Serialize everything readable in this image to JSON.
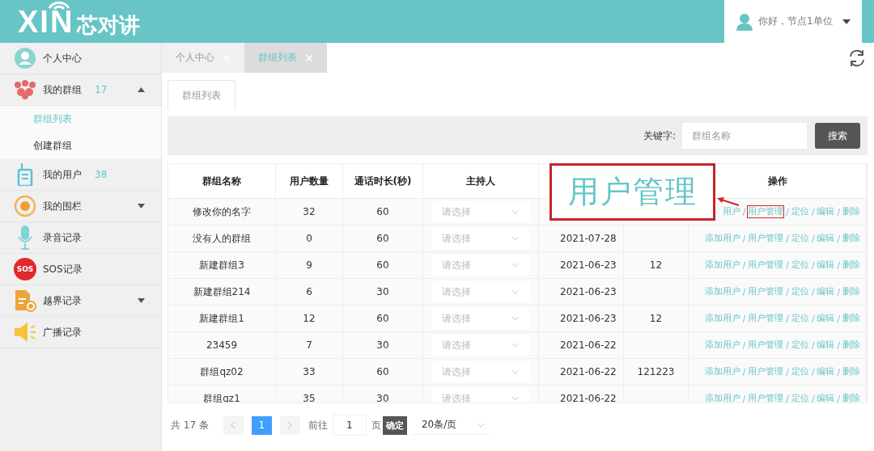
{
  "header": {
    "logo": {
      "latin": "XIN",
      "cjk": "芯对讲"
    },
    "user": {
      "greeting": "你好，节点1单位"
    }
  },
  "sidebar": {
    "items": [
      {
        "kind": "avatar",
        "label": "个人中心"
      },
      {
        "kind": "group",
        "label": "我的群组",
        "count": "17",
        "expanded": true,
        "children": [
          {
            "label": "群组列表",
            "selected": true
          },
          {
            "label": "创建群组",
            "selected": false
          }
        ]
      },
      {
        "kind": "radio",
        "label": "我的用户",
        "count": "38"
      },
      {
        "kind": "fence",
        "label": "我的围栏",
        "expanded": false
      },
      {
        "kind": "mic",
        "label": "录音记录"
      },
      {
        "kind": "sos",
        "icon_text": "SOS",
        "label": "SOS记录"
      },
      {
        "kind": "document",
        "label": "越界记录",
        "expanded": false
      },
      {
        "kind": "speaker",
        "label": "广播记录"
      }
    ]
  },
  "tabs": [
    {
      "label": "个人中心",
      "selected": false
    },
    {
      "label": "群组列表",
      "selected": true
    }
  ],
  "inner_tabs": [
    {
      "label": "群组列表",
      "selected": true
    }
  ],
  "search": {
    "label": "关键字:",
    "placeholder": "群组名称",
    "button": "搜索"
  },
  "table": {
    "columns": [
      "群组名称",
      "用户数量",
      "通话时长(秒)",
      "主持人",
      "操作"
    ],
    "rows": [
      {
        "name": "修改你的名字",
        "users": "32",
        "duration": "60",
        "host_placeholder": "请选择",
        "callout": true,
        "actions": [
          {
            "label": "用户"
          },
          {
            "separator": "/",
            "label": "用户管理"
          },
          {
            "separator": "/",
            "label": "定位"
          },
          {
            "separator": "/",
            "label": "编辑"
          },
          {
            "separator": "/",
            "label": "删除"
          }
        ]
      },
      {
        "name": "没有人的群组",
        "users": "0",
        "duration": "60",
        "host_placeholder": "请选择",
        "date": "2021-07-28",
        "actions": [
          {
            "label": "添加用户"
          },
          {
            "separator": "/",
            "label": "用户管理"
          },
          {
            "separator": "/",
            "label": "定位"
          },
          {
            "separator": "/",
            "label": "编辑"
          },
          {
            "separator": "/",
            "label": "删除"
          }
        ]
      },
      {
        "name": "新建群组3",
        "users": "9",
        "duration": "60",
        "host_placeholder": "请选择",
        "date": "2021-06-23",
        "extra": "12",
        "actions": [
          {
            "label": "添加用户"
          },
          {
            "separator": "/",
            "label": "用户管理"
          },
          {
            "separator": "/",
            "label": "定位"
          },
          {
            "separator": "/",
            "label": "编辑"
          },
          {
            "separator": "/",
            "label": "删除"
          }
        ]
      },
      {
        "name": "新建群组214",
        "users": "6",
        "duration": "30",
        "host_placeholder": "请选择",
        "date": "2021-06-23",
        "actions": [
          {
            "label": "添加用户"
          },
          {
            "separator": "/",
            "label": "用户管理"
          },
          {
            "separator": "/",
            "label": "定位"
          },
          {
            "separator": "/",
            "label": "编辑"
          },
          {
            "separator": "/",
            "label": "删除"
          }
        ]
      },
      {
        "name": "新建群组1",
        "users": "12",
        "duration": "60",
        "host_placeholder": "请选择",
        "date": "2021-06-23",
        "extra": "12",
        "actions": [
          {
            "label": "添加用户"
          },
          {
            "separator": "/",
            "label": "用户管理"
          },
          {
            "separator": "/",
            "label": "定位"
          },
          {
            "separator": "/",
            "label": "编辑"
          },
          {
            "separator": "/",
            "label": "删除"
          }
        ]
      },
      {
        "name": "23459",
        "users": "7",
        "duration": "30",
        "host_placeholder": "请选择",
        "date": "2021-06-22",
        "actions": [
          {
            "label": "添加用户"
          },
          {
            "separator": "/",
            "label": "用户管理"
          },
          {
            "separator": "/",
            "label": "定位"
          },
          {
            "separator": "/",
            "label": "编辑"
          },
          {
            "separator": "/",
            "label": "删除"
          }
        ]
      },
      {
        "name": "群组qz02",
        "users": "33",
        "duration": "60",
        "host_placeholder": "请选择",
        "date": "2021-06-22",
        "extra": "121223",
        "actions": [
          {
            "label": "添加用户"
          },
          {
            "separator": "/",
            "label": "用户管理"
          },
          {
            "separator": "/",
            "label": "定位"
          },
          {
            "separator": "/",
            "label": "编辑"
          },
          {
            "separator": "/",
            "label": "删除"
          }
        ]
      },
      {
        "name": "群组qz1",
        "users": "35",
        "duration": "30",
        "host_placeholder": "请选择",
        "date": "2021-06-22",
        "actions": [
          {
            "label": "添加用户"
          },
          {
            "separator": "/",
            "label": "用户管理"
          },
          {
            "separator": "/",
            "label": "定位"
          },
          {
            "separator": "/",
            "label": "编辑"
          },
          {
            "separator": "/",
            "label": "删除"
          }
        ]
      }
    ]
  },
  "callout": {
    "text": "用户管理"
  },
  "pagination": {
    "total": "共 17 条",
    "pages": [
      {
        "label": "1",
        "selected": true
      }
    ],
    "goto_label": "前往",
    "goto_value": "1",
    "page_unit": "页",
    "confirm": "确定",
    "page_size": "20条/页"
  }
}
